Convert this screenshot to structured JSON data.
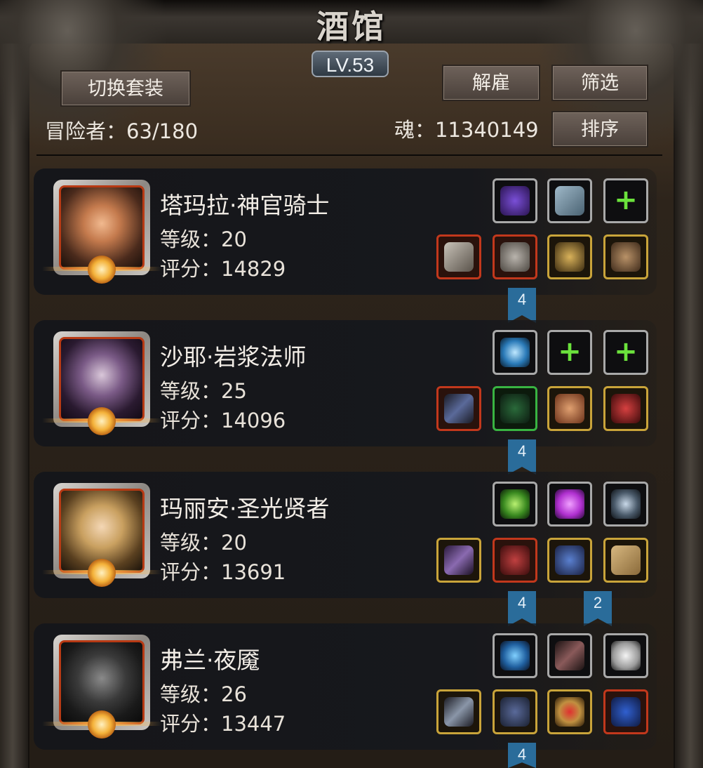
{
  "header": {
    "title": "酒馆",
    "level": "LV.53"
  },
  "toolbar": {
    "switch_set_label": "切换套装",
    "dismiss_label": "解雇",
    "filter_label": "筛选",
    "sort_label": "排序"
  },
  "stats": {
    "adventurers": "冒险者：63/180",
    "soul": "魂：11340149"
  },
  "heroes": [
    {
      "name": "塔玛拉·神官骑士",
      "level": "等级：20",
      "score": "评分：14829",
      "set_counts": [
        "4"
      ],
      "equipment_icons": [
        "dark-orb-icon",
        "book-icon",
        "empty-slot-plus-icon",
        "hammer-icon",
        "armor-icon",
        "amulet-icon",
        "mask-icon"
      ]
    },
    {
      "name": "沙耶·岩浆法师",
      "level": "等级：25",
      "score": "评分：14096",
      "set_counts": [
        "4"
      ],
      "equipment_icons": [
        "blue-orb-icon",
        "empty-slot-plus-icon",
        "empty-slot-plus-icon",
        "staff-icon",
        "robe-icon",
        "bracelet-icon",
        "necklace-icon"
      ]
    },
    {
      "name": "玛丽安·圣光贤者",
      "level": "等级：20",
      "score": "评分：13691",
      "set_counts": [
        "4",
        "2"
      ],
      "equipment_icons": [
        "green-crystal-icon",
        "purple-gem-icon",
        "emblem-icon",
        "scepter-icon",
        "red-cloak-icon",
        "pendant-icon",
        "scroll-icon"
      ]
    },
    {
      "name": "弗兰·夜魇",
      "level": "等级：26",
      "score": "评分：13447",
      "set_counts": [
        "4"
      ],
      "equipment_icons": [
        "blue-swirl-icon",
        "feather-icon",
        "white-stone-icon",
        "dagger-icon",
        "plate-armor-icon",
        "ruby-ring-icon",
        "blue-ring-icon"
      ]
    }
  ]
}
